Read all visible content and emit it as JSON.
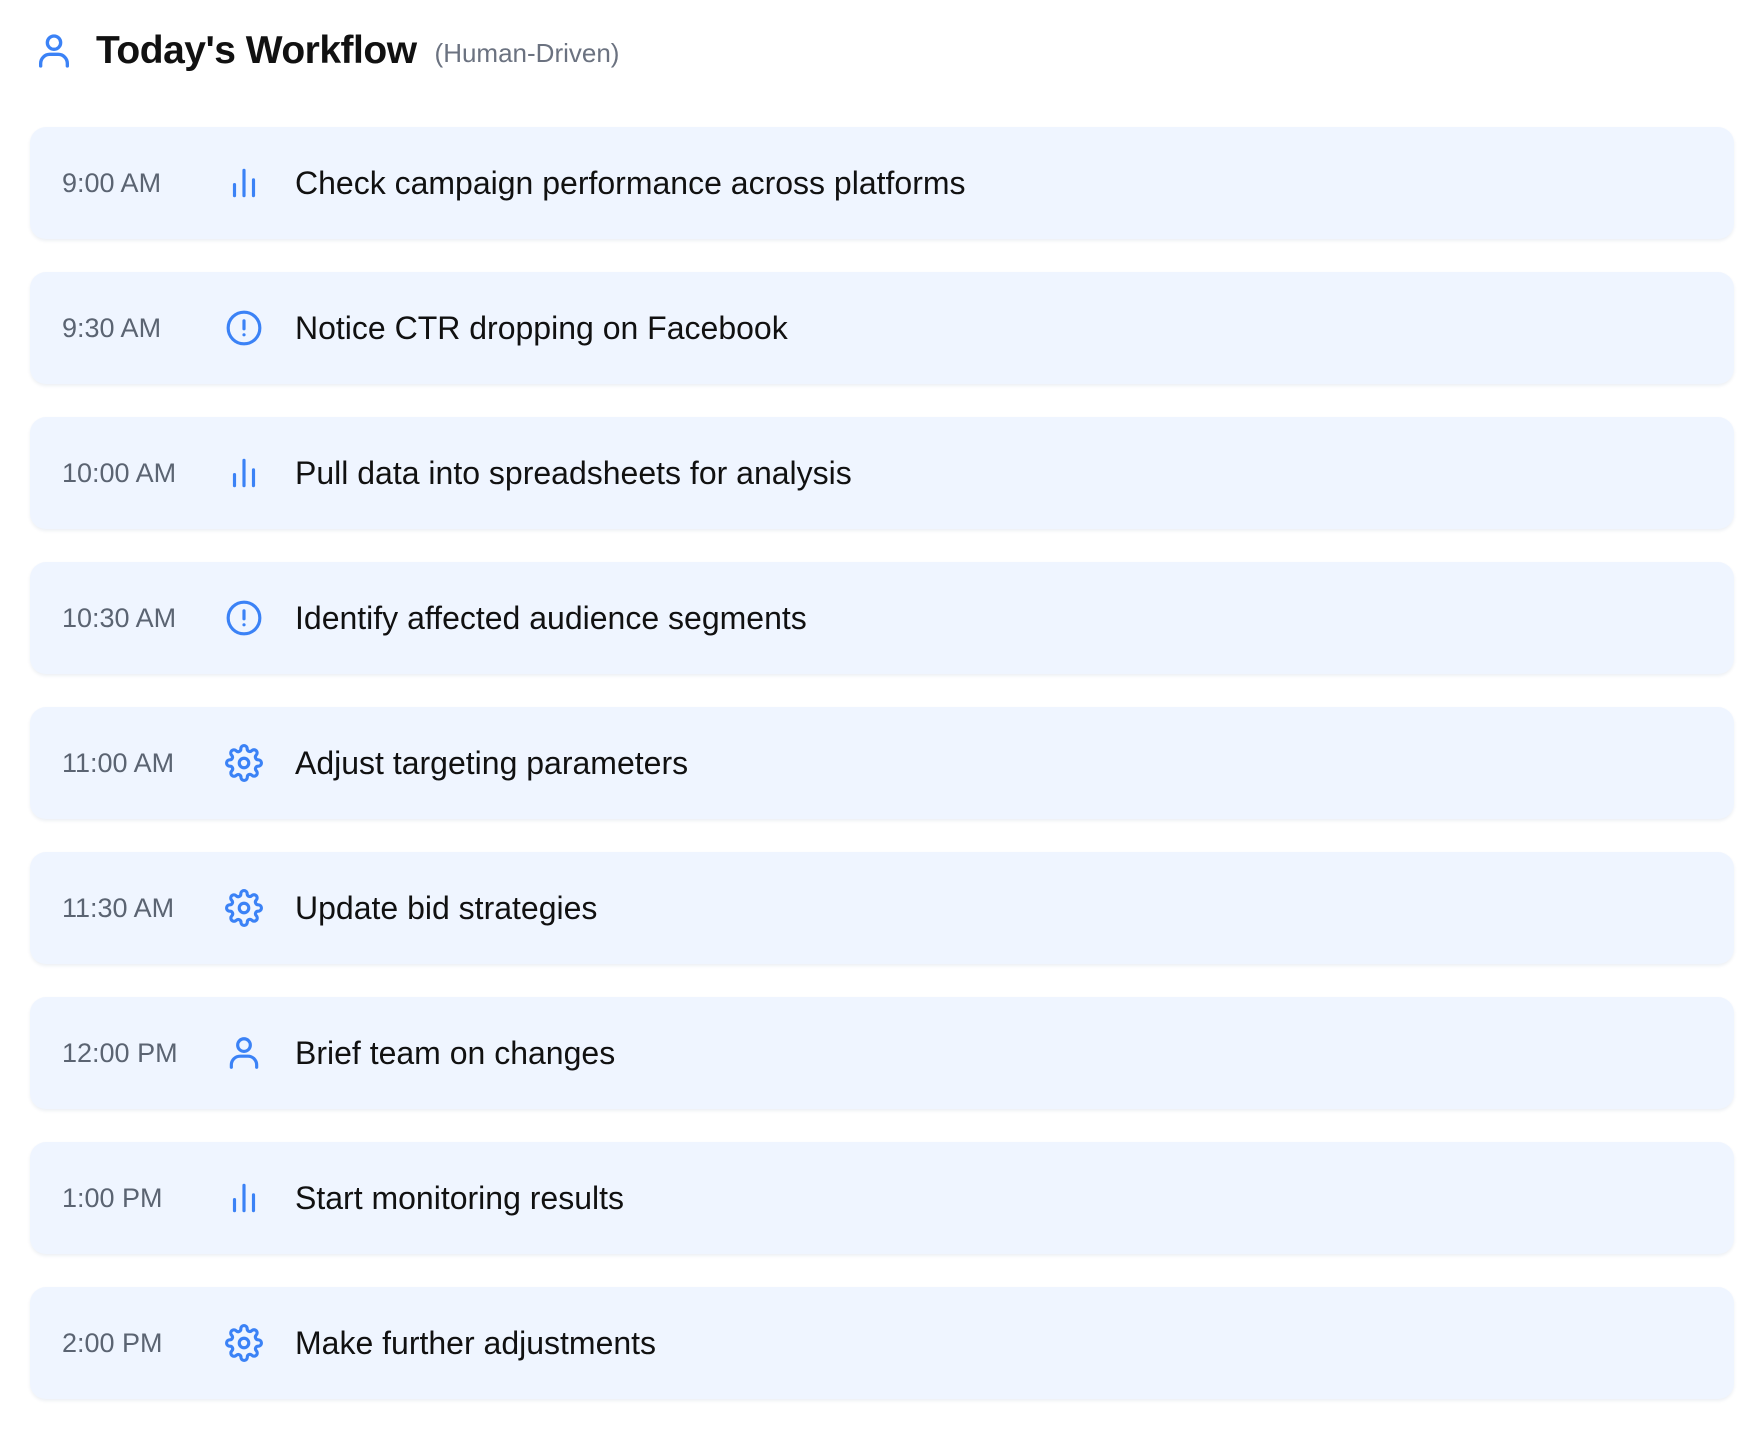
{
  "header": {
    "icon": "user-icon",
    "title": "Today's Workflow",
    "subtitle": "(Human-Driven)"
  },
  "accent_color": "#3b82f6",
  "tasks": [
    {
      "time": "9:00 AM",
      "icon": "bar-chart-icon",
      "text": "Check campaign performance across platforms"
    },
    {
      "time": "9:30 AM",
      "icon": "alert-circle-icon",
      "text": "Notice CTR dropping on Facebook"
    },
    {
      "time": "10:00 AM",
      "icon": "bar-chart-icon",
      "text": "Pull data into spreadsheets for analysis"
    },
    {
      "time": "10:30 AM",
      "icon": "alert-circle-icon",
      "text": "Identify affected audience segments"
    },
    {
      "time": "11:00 AM",
      "icon": "gear-icon",
      "text": "Adjust targeting parameters"
    },
    {
      "time": "11:30 AM",
      "icon": "gear-icon",
      "text": "Update bid strategies"
    },
    {
      "time": "12:00 PM",
      "icon": "user-icon",
      "text": "Brief team on changes"
    },
    {
      "time": "1:00 PM",
      "icon": "bar-chart-icon",
      "text": "Start monitoring results"
    },
    {
      "time": "2:00 PM",
      "icon": "gear-icon",
      "text": "Make further adjustments"
    }
  ]
}
